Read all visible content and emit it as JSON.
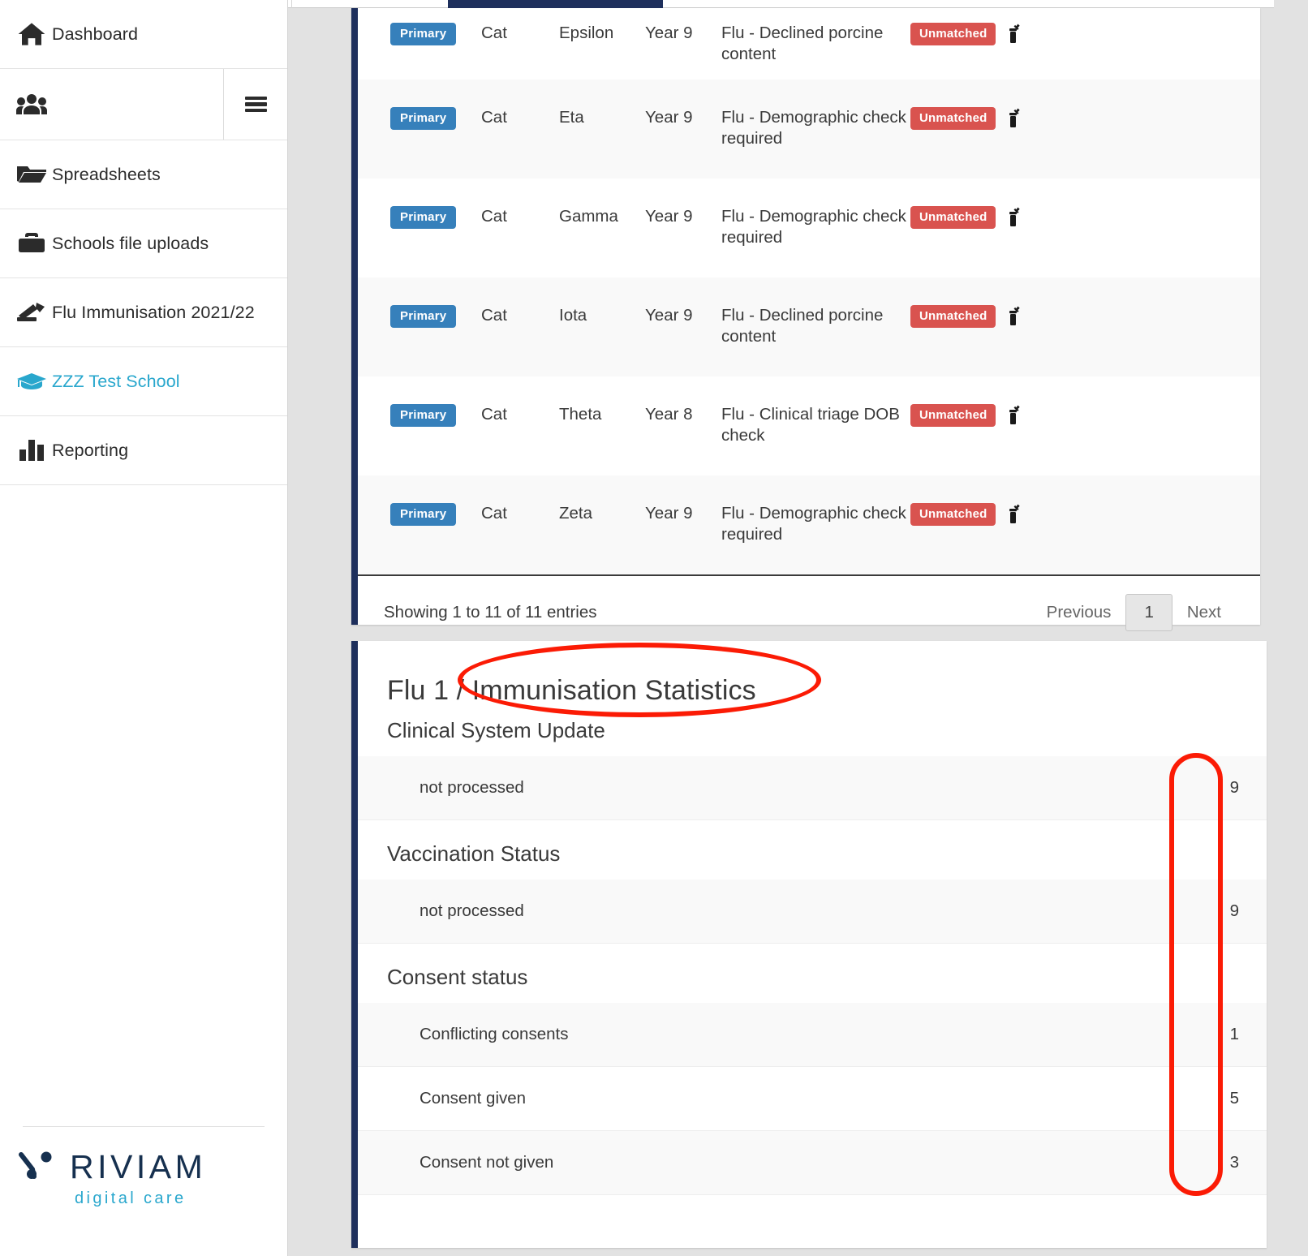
{
  "tabstrip": {
    "active_tab_label": ""
  },
  "sidebar": {
    "items": [
      {
        "label": "Dashboard",
        "icon": "home-icon",
        "active": false
      },
      {
        "label": "",
        "icon": "users-icon",
        "active": false,
        "has_menu_button": true
      },
      {
        "label": "Spreadsheets",
        "icon": "folder-icon",
        "active": false
      },
      {
        "label": "Schools file uploads",
        "icon": "briefcase-icon",
        "active": false
      },
      {
        "label": "Flu Immunisation 2021/22",
        "icon": "vaccine-stack-icon",
        "active": false
      },
      {
        "label": "ZZZ Test School",
        "icon": "graduation-cap-icon",
        "active": true
      },
      {
        "label": "Reporting",
        "icon": "bar-chart-icon",
        "active": false
      }
    ],
    "brand": {
      "name": "RIVIAM",
      "tagline": "digital care"
    }
  },
  "table": {
    "columns": [
      "type",
      "first_name",
      "last_name",
      "year_group",
      "status_reason",
      "match_status",
      "action"
    ],
    "rows": [
      {
        "type": "Primary",
        "first_name": "Cat",
        "last_name": "Epsilon",
        "year_group": "Year 9",
        "status_reason": "Flu - Declined porcine content",
        "match_status": "Unmatched",
        "action_icon": "vaccine-icon"
      },
      {
        "type": "Primary",
        "first_name": "Cat",
        "last_name": "Eta",
        "year_group": "Year 9",
        "status_reason": "Flu - Demographic check required",
        "match_status": "Unmatched",
        "action_icon": "vaccine-icon"
      },
      {
        "type": "Primary",
        "first_name": "Cat",
        "last_name": "Gamma",
        "year_group": "Year 9",
        "status_reason": "Flu - Demographic check required",
        "match_status": "Unmatched",
        "action_icon": "vaccine-icon"
      },
      {
        "type": "Primary",
        "first_name": "Cat",
        "last_name": "Iota",
        "year_group": "Year 9",
        "status_reason": "Flu - Declined porcine content",
        "match_status": "Unmatched",
        "action_icon": "vaccine-icon"
      },
      {
        "type": "Primary",
        "first_name": "Cat",
        "last_name": "Theta",
        "year_group": "Year 8",
        "status_reason": "Flu - Clinical triage DOB check",
        "match_status": "Unmatched",
        "action_icon": "vaccine-icon"
      },
      {
        "type": "Primary",
        "first_name": "Cat",
        "last_name": "Zeta",
        "year_group": "Year 9",
        "status_reason": "Flu - Demographic check required",
        "match_status": "Unmatched",
        "action_icon": "vaccine-icon"
      }
    ],
    "pagination": {
      "info": "Showing 1 to 11 of 11 entries",
      "previous": "Previous",
      "page": "1",
      "next": "Next"
    }
  },
  "stats": {
    "title": "Flu 1 / Immunisation Statistics",
    "sections": [
      {
        "heading": "Clinical System Update",
        "rows": [
          {
            "label": "not processed",
            "value": "9"
          }
        ]
      },
      {
        "heading": "Vaccination Status",
        "rows": [
          {
            "label": "not processed",
            "value": "9"
          }
        ]
      },
      {
        "heading": "Consent status",
        "rows": [
          {
            "label": "Conflicting consents",
            "value": "1"
          },
          {
            "label": "Consent given",
            "value": "5"
          },
          {
            "label": "Consent not given",
            "value": "3"
          }
        ]
      }
    ]
  },
  "annotations": {
    "ellipse_target": "Immunisation Statistics",
    "rect_target": "statistics-value-column",
    "color": "#fb1b05"
  },
  "colors": {
    "accent_teal": "#29a7cd",
    "panel_border_navy": "#1e2f5c",
    "badge_primary": "#3680bb",
    "badge_danger": "#d9534f",
    "annotation_red": "#fb1b05"
  }
}
